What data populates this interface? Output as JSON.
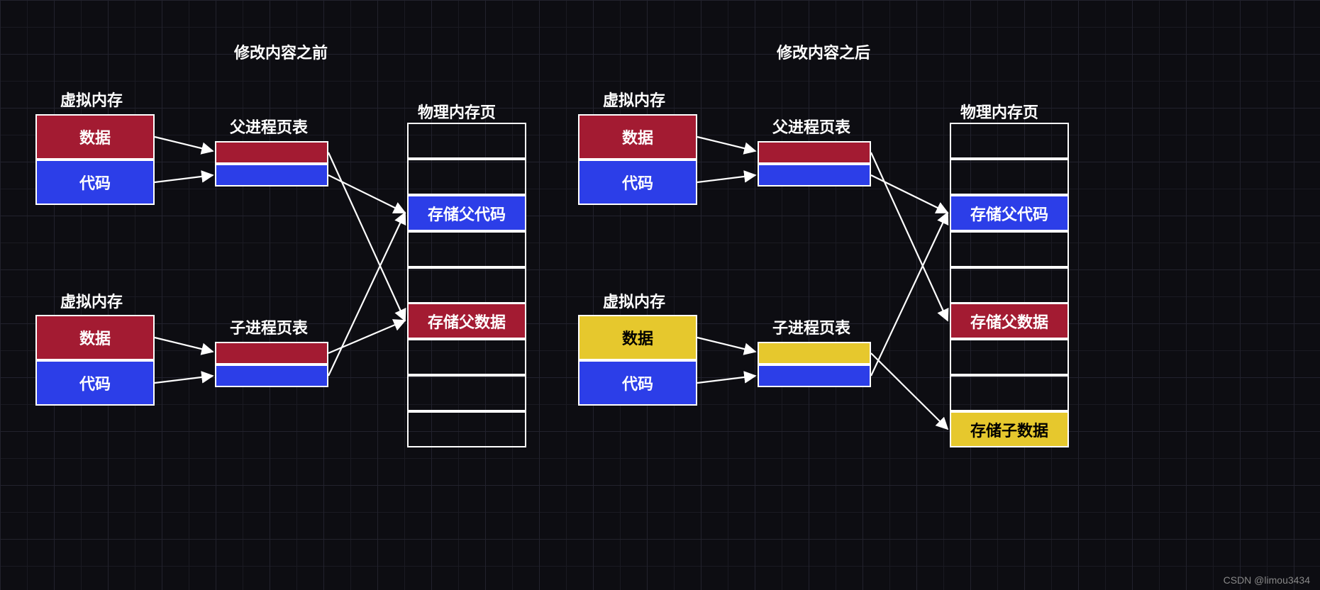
{
  "titles": {
    "before": "修改内容之前",
    "after": "修改内容之后"
  },
  "labels": {
    "virtualMemory": "虚拟内存",
    "parentPageTable": "父进程页表",
    "childPageTable": "子进程页表",
    "physicalPage": "物理内存页"
  },
  "cells": {
    "data": "数据",
    "code": "代码",
    "storeParentCode": "存储父代码",
    "storeParentData": "存储父数据",
    "storeChildData": "存储子数据"
  },
  "watermark": "CSDN @limou3434",
  "colors": {
    "red": "#a31b32",
    "blue": "#2c3ee8",
    "yellow": "#e6c82d"
  },
  "diagram": {
    "description": "Two side-by-side diagrams showing copy-on-write: before modification, parent and child virtual memory map via page tables to shared physical pages; after modification, child data page is duplicated (yellow) into a new physical page.",
    "left": {
      "title": "before",
      "parent_vm": [
        "data(red)",
        "code(blue)"
      ],
      "child_vm": [
        "data(red)",
        "code(blue)"
      ],
      "parent_pt": [
        "red",
        "blue"
      ],
      "child_pt": [
        "red",
        "blue"
      ],
      "physical": [
        "empty",
        "empty",
        "storeParentCode(blue)",
        "empty",
        "storeParentData(red)",
        "empty",
        "empty",
        "empty"
      ],
      "arrows": [
        "parent_vm->parent_pt",
        "child_vm->child_pt",
        "parent_pt.red->phys[4]",
        "parent_pt.blue->phys[2]",
        "child_pt.red->phys[4]",
        "child_pt.blue->phys[2]"
      ]
    },
    "right": {
      "title": "after",
      "parent_vm": [
        "data(red)",
        "code(blue)"
      ],
      "child_vm": [
        "data(yellow)",
        "code(blue)"
      ],
      "parent_pt": [
        "red",
        "blue"
      ],
      "child_pt": [
        "yellow",
        "blue"
      ],
      "physical": [
        "empty",
        "empty",
        "storeParentCode(blue)",
        "empty",
        "storeParentData(red)",
        "empty",
        "empty",
        "storeChildData(yellow)"
      ],
      "arrows": [
        "parent_vm->parent_pt",
        "child_vm->child_pt",
        "parent_pt.red->phys[4]",
        "parent_pt.blue->phys[2]",
        "child_pt.yellow->phys[7]",
        "child_pt.blue->phys[2]"
      ]
    }
  }
}
